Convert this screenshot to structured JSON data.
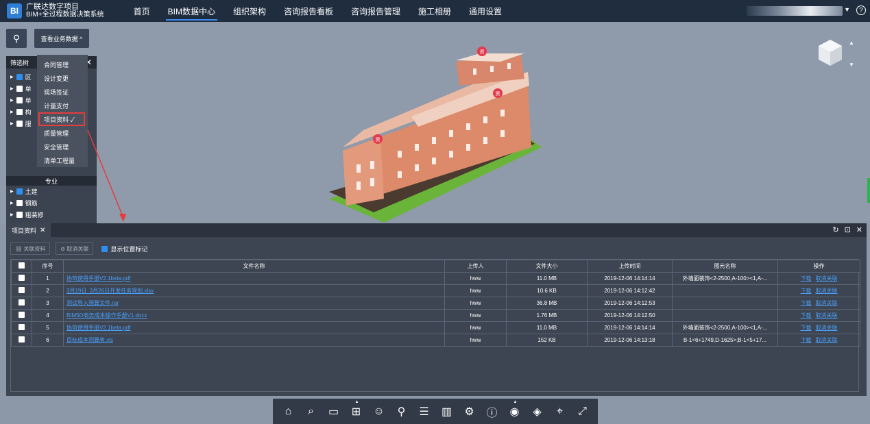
{
  "app": {
    "logo_text": "BI",
    "title_line1": "广联达数字项目",
    "title_line2": "BIM+全过程数据决策系统"
  },
  "nav": {
    "items": [
      {
        "label": "首页",
        "active": false
      },
      {
        "label": "BIM数据中心",
        "active": true
      },
      {
        "label": "组织架构",
        "active": false
      },
      {
        "label": "咨询报告看板",
        "active": false
      },
      {
        "label": "咨询报告管理",
        "active": false
      },
      {
        "label": "施工相册",
        "active": false
      },
      {
        "label": "通用设置",
        "active": false
      }
    ],
    "help_icon": "?"
  },
  "viewer": {
    "dropdown_label": "查看业务数据 ^",
    "menu_items": [
      "合同管理",
      "设计变更",
      "现场签证",
      "计量支付",
      "项目资料 ✓",
      "质量管理",
      "安全管理",
      "清单工程量"
    ],
    "selected_index": 4
  },
  "filter_tree": {
    "title": "筛选树",
    "close": "✕",
    "rows": [
      {
        "label": "区",
        "checked": true
      },
      {
        "label": "单",
        "checked": false
      },
      {
        "label": "单",
        "checked": false
      },
      {
        "label": "构",
        "checked": false
      },
      {
        "label": "服",
        "checked": false
      }
    ],
    "section_title": "专业",
    "discipline_rows": [
      {
        "label": "土建",
        "checked": true
      },
      {
        "label": "钢筋",
        "checked": false
      },
      {
        "label": "粗装修",
        "checked": false
      }
    ]
  },
  "marker_label": "资",
  "panel": {
    "tab_label": "项目资料",
    "tab_close": "✕",
    "icons": [
      "refresh-icon",
      "expand-icon",
      "close-icon"
    ],
    "toolbar": {
      "link_btn": "关联资料",
      "unlink_btn": "取消关联",
      "show_marker_label": "显示位置标记",
      "show_marker_checked": true
    },
    "columns": [
      "序号",
      "文件名称",
      "上传人",
      "文件大小",
      "上传时间",
      "图元名称",
      "操作"
    ],
    "rows": [
      {
        "no": "1",
        "file": "协筑使用手册V2.1beta.pdf",
        "uploader": "hww",
        "size": "11.0 MB",
        "time": "2019-12-06 14:14:14",
        "element": "外墙面装饰<2-2500,A-100><1,A-...",
        "op1": "下载",
        "op2": "取消关联"
      },
      {
        "no": "2",
        "file": "3月19日_3月26日开发任务规划.xlsx",
        "uploader": "hww",
        "size": "10.6 KB",
        "time": "2019-12-06 14:12:42",
        "element": "",
        "op1": "下载",
        "op2": "取消关联"
      },
      {
        "no": "3",
        "file": "测试导入预算文件.rar",
        "uploader": "hww",
        "size": "36.8 MB",
        "time": "2019-12-06 14:12:53",
        "element": "",
        "op1": "下载",
        "op2": "取消关联"
      },
      {
        "no": "4",
        "file": "BIM5D商务成本操作手册V1.docx",
        "uploader": "hww",
        "size": "1.76 MB",
        "time": "2019-12-06 14:12:50",
        "element": "",
        "op1": "下载",
        "op2": "取消关联"
      },
      {
        "no": "5",
        "file": "协筑使用手册V2.1beta.pdf",
        "uploader": "hww",
        "size": "11.0 MB",
        "time": "2019-12-06 14:14:14",
        "element": "外墙面装饰<2-2500,A-100><1,A-...",
        "op1": "下载",
        "op2": "取消关联"
      },
      {
        "no": "6",
        "file": "目标成本测算表.xls",
        "uploader": "hww",
        "size": "152 KB",
        "time": "2019-12-06 14:13:18",
        "element": "B-1<6+1749,D-1625>;B-1<5+17...",
        "op1": "下载",
        "op2": "取消关联"
      }
    ]
  },
  "bottom_toolbar": [
    "home-icon",
    "zoom-box-icon",
    "measure-icon",
    "section-icon",
    "person-icon",
    "roam-icon",
    "list-icon",
    "chart-icon",
    "settings-icon",
    "info-icon",
    "model-icon",
    "cube-icon",
    "location-icon",
    "fullscreen-icon"
  ],
  "colors": {
    "accent": "#3d8ef0",
    "highlight_red": "#e53c3c",
    "link": "#4a9df5",
    "topbar": "#1f2d3f"
  }
}
